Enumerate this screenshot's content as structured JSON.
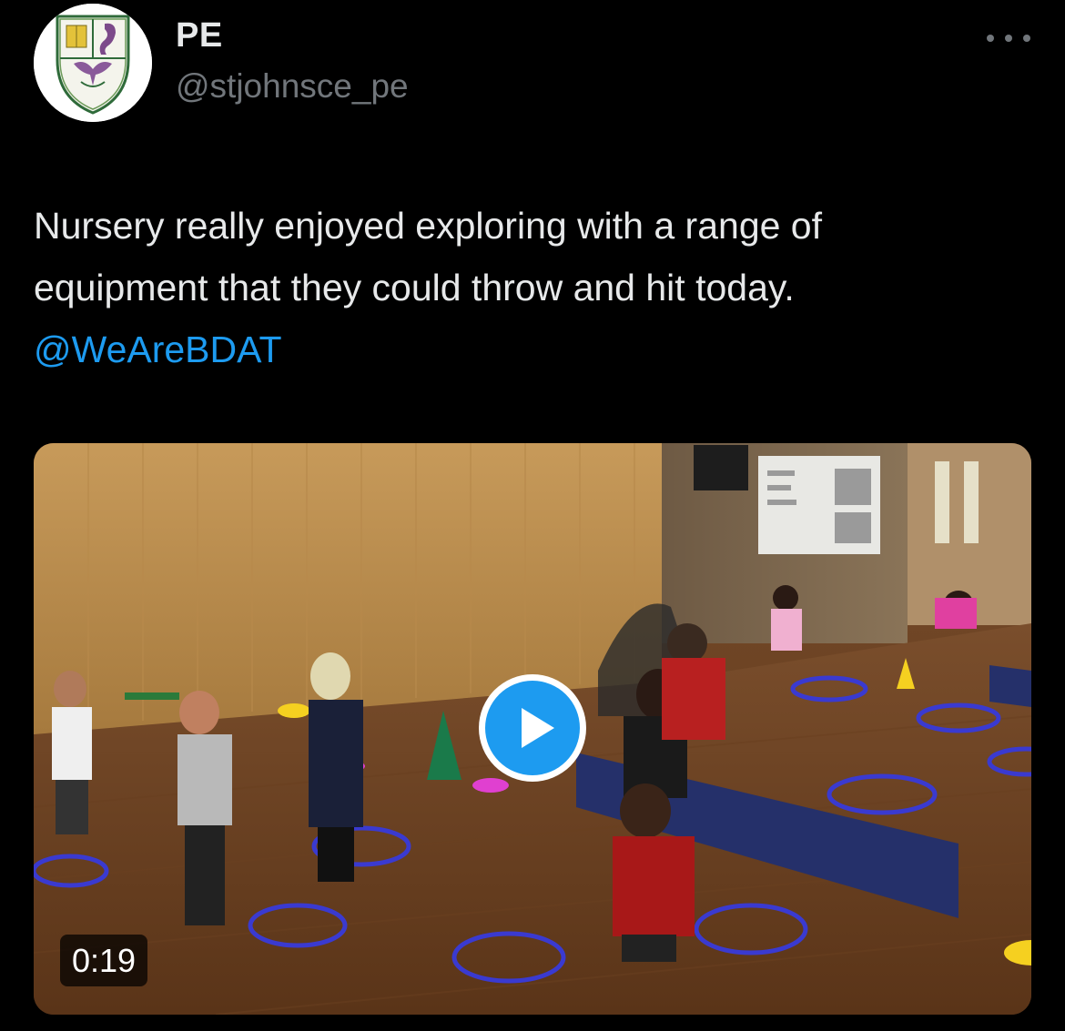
{
  "author": {
    "display_name": "PE",
    "handle": "@stjohnsce_pe",
    "avatar_icon": "school-crest-icon"
  },
  "more_icon": "more-options-icon",
  "tweet": {
    "text_lines": [
      "Nursery really enjoyed exploring with a range of",
      "equipment that they could throw and hit today."
    ],
    "mention": "@WeAreBDAT"
  },
  "media": {
    "type": "video",
    "duration": "0:19",
    "play_icon": "play-icon"
  },
  "colors": {
    "background": "#000000",
    "text": "#e7e9ea",
    "secondary_text": "#71767b",
    "link": "#1d9bf0",
    "play_button": "#1d9bf0"
  }
}
